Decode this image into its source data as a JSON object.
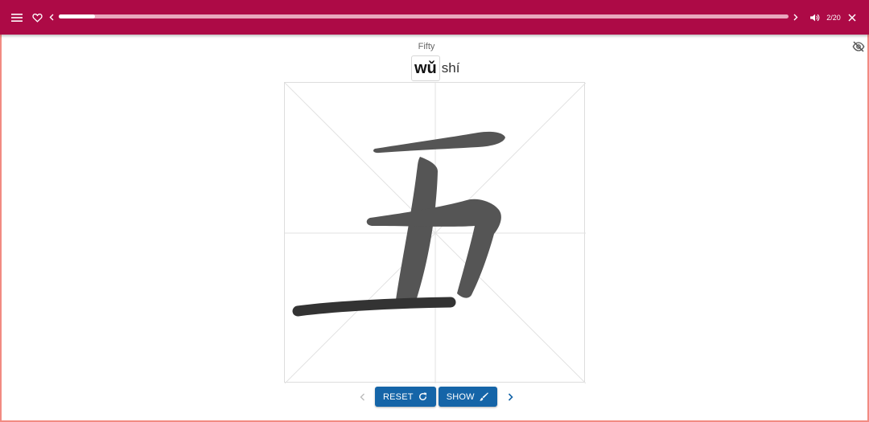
{
  "header": {
    "menu_icon": "menu-icon",
    "favorite_icon": "heart-icon",
    "prev_icon": "chevron-left-icon",
    "next_icon": "chevron-right-icon",
    "audio_icon": "volume-icon",
    "close_icon": "close-icon",
    "progress_fraction": 0.05,
    "counter": "2/20",
    "bar_color": "#ad0a46"
  },
  "card": {
    "translation": "Fifty",
    "pinyin_active": "wǔ",
    "pinyin_rest": "shí",
    "visibility_icon": "eye-off-icon",
    "character": "五"
  },
  "controls": {
    "prev_icon": "chevron-left-icon",
    "reset_label": "RESET",
    "reset_icon": "refresh-icon",
    "show_label": "SHOW",
    "show_icon": "brush-icon",
    "next_icon": "chevron-right-icon",
    "button_color": "#1565a8"
  }
}
